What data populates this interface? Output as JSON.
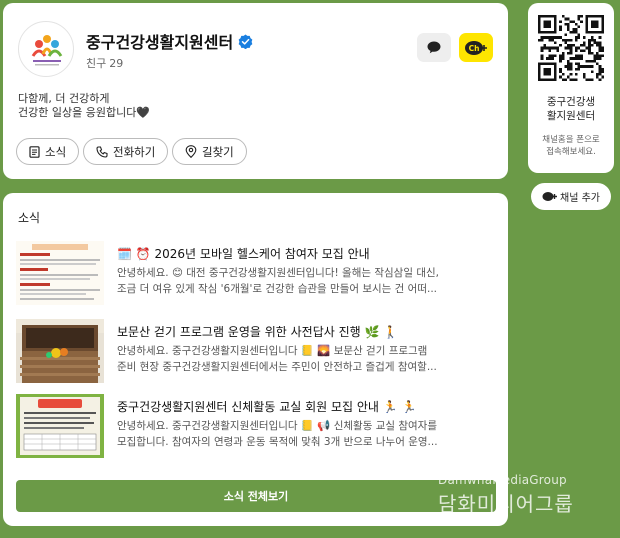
{
  "profile": {
    "name": "중구건강생활지원센터",
    "friends_label": "친구",
    "friends_count": "29",
    "description": [
      "다함께, 더 건강하게",
      "건강한 일상을 응원합니다🖤"
    ],
    "buttons": {
      "news": "소식",
      "call": "전화하기",
      "directions": "길찾기"
    },
    "ch_badge": "Ch"
  },
  "news": {
    "section_title": "소식",
    "items": [
      {
        "title": "🗓️ ⏰ 2026년 모바일 헬스케어 참여자 모집 안내",
        "body": [
          "안녕하세요. 😊 대전 중구건강생활지원센터입니다! 올해는 작심삼일 대신,",
          "조금 더 여유 있게 작심 '6개월'로 건강한 습관을 만들어 보시는 건 어떠..."
        ]
      },
      {
        "title": "보문산 걷기 프로그램 운영을 위한 사전답사 진행 🌿 🚶",
        "body": [
          "안녕하세요. 중구건강생활지원센터입니다 📒 🌄 보문산 걷기 프로그램",
          "준비 현장 중구건강생활지원센터에서는 주민이 안전하고 즐겁게 참여할..."
        ]
      },
      {
        "title": "중구건강생활지원센터 신체활동 교실 회원 모집 안내 🏃 🏃",
        "body": [
          "안녕하세요. 중구건강생활지원센터입니다 📒 📢 신체활동 교실 참여자를",
          "모집합니다. 참여자의 연령과 운동 목적에 맞춰 3개 반으로 나누어 운영..."
        ]
      }
    ],
    "view_all": "소식 전체보기"
  },
  "sidebar": {
    "qr_title": [
      "중구건강생",
      "활지원센터"
    ],
    "qr_sub": [
      "채널홈을 폰으로",
      "접속해보세요."
    ],
    "add_channel": "채널 추가"
  },
  "watermark": {
    "en": "DamwhaMediaGroup",
    "ko": "담화미디어그룹"
  },
  "icons": [
    "chat-bubble-icon",
    "channel-plus-icon",
    "verified-badge-icon",
    "document-icon",
    "phone-icon",
    "location-pin-icon",
    "qr-code-icon"
  ],
  "colors": {
    "background": "#6b9a47",
    "kakao_yellow": "#fee500",
    "verified_blue": "#1a7fe0"
  }
}
